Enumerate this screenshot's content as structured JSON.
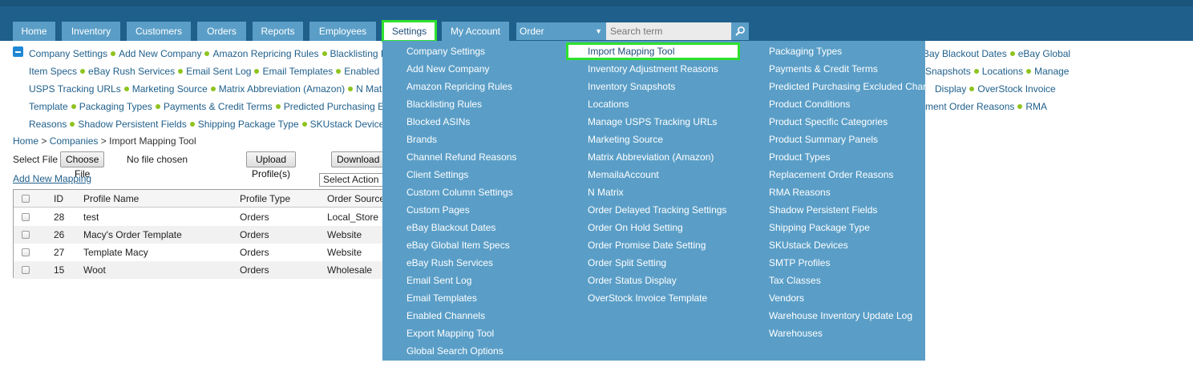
{
  "nav": {
    "tabs": [
      "Home",
      "Inventory",
      "Customers",
      "Orders",
      "Reports",
      "Employees",
      "Settings",
      "My Account"
    ],
    "order_select": "Order",
    "search_placeholder": "Search term"
  },
  "settings_links": {
    "row1": [
      "Company Settings",
      "Add New Company",
      "Amazon Repricing Rules",
      "Blacklisting R"
    ],
    "row2": [
      "Item Specs",
      "eBay Rush Services",
      "Email Sent Log",
      "Email Templates",
      "Enabled C"
    ],
    "row3": [
      "USPS Tracking URLs",
      "Marketing Source",
      "Matrix Abbreviation (Amazon)",
      "N Matr"
    ],
    "row4": [
      "Template",
      "Packaging Types",
      "Payments & Credit Terms",
      "Predicted Purchasing E"
    ],
    "row5": [
      "Reasons",
      "Shadow Persistent Fields",
      "Shipping Package Type",
      "SKUstack Device"
    ],
    "right1": [
      "Bay Blackout Dates",
      "eBay Global"
    ],
    "right2": [
      "Snapshots",
      "Locations",
      "Manage"
    ],
    "right3": [
      "Display",
      "OverStock Invoice"
    ],
    "right4": [
      "ment Order Reasons",
      "RMA"
    ]
  },
  "breadcrumb": {
    "home": "Home",
    "sep": ">",
    "companies": "Companies",
    "current": "Import Mapping Tool"
  },
  "file_row": {
    "label": "Select File",
    "choose": "Choose File",
    "status": "No file chosen",
    "upload": "Upload Profile(s)",
    "download": "Download"
  },
  "add_mapping": "Add New Mapping",
  "select_action": "Select Action",
  "table": {
    "headers": [
      "ID",
      "Profile Name",
      "Profile Type",
      "Order Source"
    ],
    "rows": [
      {
        "id": "28",
        "name": "test",
        "type": "Orders",
        "source": "Local_Store"
      },
      {
        "id": "26",
        "name": "Macy's Order Template",
        "type": "Orders",
        "source": "Website"
      },
      {
        "id": "27",
        "name": "Template Macy",
        "type": "Orders",
        "source": "Website"
      },
      {
        "id": "15",
        "name": "Woot",
        "type": "Orders",
        "source": "Wholesale"
      }
    ]
  },
  "menu": {
    "col1": [
      "Company Settings",
      "Add New Company",
      "Amazon Repricing Rules",
      "Blacklisting Rules",
      "Blocked ASINs",
      "Brands",
      "Channel Refund Reasons",
      "Client Settings",
      "Custom Column Settings",
      "Custom Pages",
      "eBay Blackout Dates",
      "eBay Global Item Specs",
      "eBay Rush Services",
      "Email Sent Log",
      "Email Templates",
      "Enabled Channels",
      "Export Mapping Tool",
      "Global Search Options"
    ],
    "col2": [
      "Import Mapping Tool",
      "Inventory Adjustment Reasons",
      "Inventory Snapshots",
      "Locations",
      "Manage USPS Tracking URLs",
      "Marketing Source",
      "Matrix Abbreviation (Amazon)",
      "MemailaAccount",
      "N Matrix",
      "Order Delayed Tracking Settings",
      "Order On Hold Setting",
      "Order Promise Date Setting",
      "Order Split Setting",
      "Order Status Display",
      "OverStock Invoice Template"
    ],
    "col3": [
      "Packaging Types",
      "Payments & Credit Terms",
      "Predicted Purchasing Excluded Chan",
      "Product Conditions",
      "Product Specific Categories",
      "Product Summary Panels",
      "Product Types",
      "Replacement Order Reasons",
      "RMA Reasons",
      "Shadow Persistent Fields",
      "Shipping Package Type",
      "SKUstack Devices",
      "SMTP Profiles",
      "Tax Classes",
      "Vendors",
      "Warehouse Inventory Update Log",
      "Warehouses"
    ]
  }
}
